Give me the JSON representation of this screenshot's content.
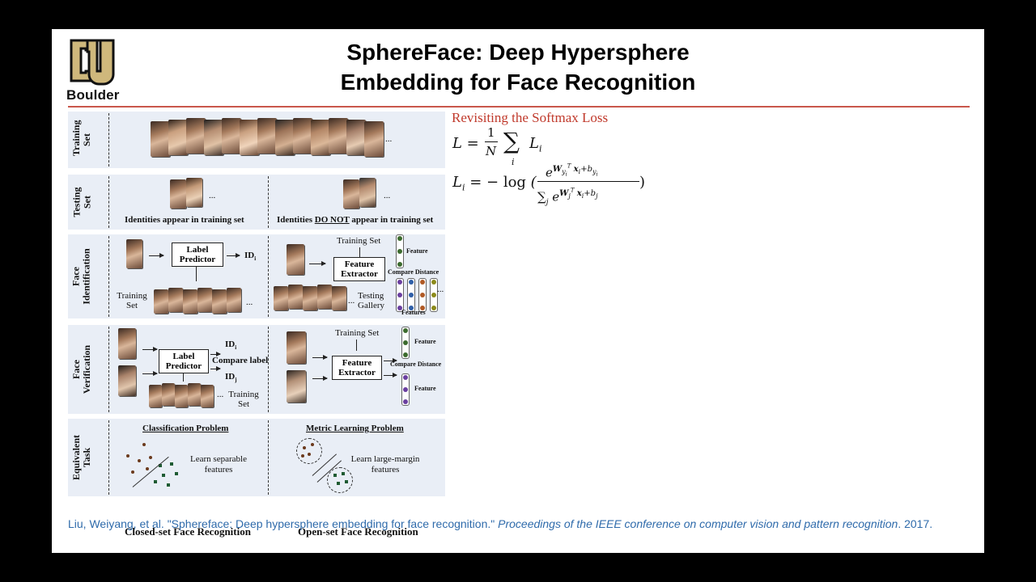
{
  "logo": {
    "text": "Boulder",
    "icon": "cu-logo-icon"
  },
  "title": {
    "line1": "SphereFace: Deep Hypersphere",
    "line2": "Embedding for Face Recognition"
  },
  "figure": {
    "rows": {
      "training": "Training Set",
      "testing": "Testing Set",
      "identification": "Face Identification",
      "verification": "Face Verification",
      "equivalent": "Equivalent Task"
    },
    "ellipsis": "...",
    "closed": {
      "testing_note": "Identities appear in training set",
      "label_predictor": "Label Predictor",
      "id_i": "ID",
      "id_j": "ID",
      "training_set": "Training Set",
      "compare_label": "Compare label",
      "problem": "Classification Problem",
      "learn": "Learn separable features",
      "caption": "Closed-set Face Recognition"
    },
    "open": {
      "testing_note_pre": "Identities ",
      "testing_note_em": "DO NOT",
      "testing_note_post": " appear in training set",
      "training_set": "Training Set",
      "feature_extractor": "Feature Extractor",
      "feature": "Feature",
      "features": "Features",
      "compare_distance": "Compare Distance",
      "testing_gallery": "Testing Gallery",
      "problem": "Metric Learning Problem",
      "learn": "Learn large-margin features",
      "caption": "Open-set Face Recognition"
    }
  },
  "section": {
    "title": "Revisiting the Softmax Loss"
  },
  "equations": {
    "eq1": "L = (1/N) Σ_i L_i",
    "eq2": "L_i = − log ( e^{W_{y_i}^T x_i + b_{y_i}} / Σ_j e^{W_j^T x_i + b_j} )"
  },
  "citation": {
    "text": "Liu, Weiyang, et al. \"Sphereface: Deep hypersphere embedding for face recognition.\" ",
    "venue": "Proceedings of the IEEE conference on computer vision and pattern recognition",
    "year": ". 2017."
  },
  "colors": {
    "background": "#000000",
    "slide": "#ffffff",
    "accent_red": "#c0392b",
    "citation_blue": "#2f6bab",
    "figure_row": "#e9eef6"
  }
}
